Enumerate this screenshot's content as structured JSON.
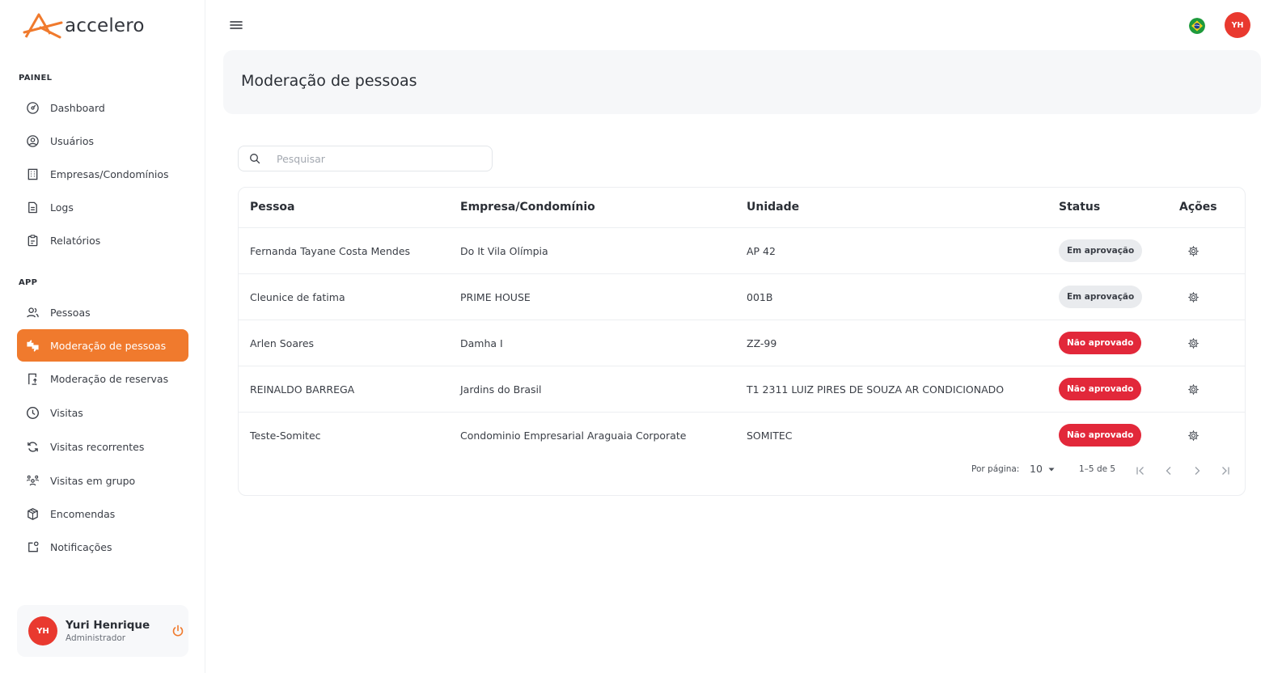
{
  "brand": {
    "name": "accelero",
    "accent": "#f07a2d",
    "avatar_color": "#e9392f"
  },
  "sidebar": {
    "section_painel": "PAINEL",
    "section_app": "APP",
    "items": [
      {
        "label": "Dashboard",
        "icon": "dashboard-icon"
      },
      {
        "label": "Usuários",
        "icon": "user-circle-icon"
      },
      {
        "label": "Empresas/Condomínios",
        "icon": "building-icon"
      },
      {
        "label": "Logs",
        "icon": "document-icon"
      },
      {
        "label": "Relatórios",
        "icon": "clipboard-icon"
      },
      {
        "label": "Pessoas",
        "icon": "people-icon"
      },
      {
        "label": "Moderação de pessoas",
        "icon": "thumbs-icon",
        "active": true
      },
      {
        "label": "Moderação de reservas",
        "icon": "reservation-icon"
      },
      {
        "label": "Visitas",
        "icon": "clock-icon"
      },
      {
        "label": "Visitas recorrentes",
        "icon": "refresh-icon"
      },
      {
        "label": "Visitas em grupo",
        "icon": "group-icon"
      },
      {
        "label": "Encomendas",
        "icon": "package-icon"
      },
      {
        "label": "Notificações",
        "icon": "notification-icon"
      }
    ]
  },
  "user": {
    "initials": "YH",
    "name": "Yuri Henrique",
    "role": "Administrador"
  },
  "topbar": {
    "avatar_initials": "YH"
  },
  "page": {
    "title": "Moderação de pessoas"
  },
  "search": {
    "placeholder": "Pesquisar"
  },
  "table": {
    "headers": {
      "pessoa": "Pessoa",
      "empresa": "Empresa/Condomínio",
      "unidade": "Unidade",
      "status": "Status",
      "acoes": "Ações"
    },
    "rows": [
      {
        "pessoa": "Fernanda Tayane Costa Mendes",
        "empresa": "Do It Vila Olímpia",
        "unidade": "AP 42",
        "status": "Em aprovação",
        "status_type": "pending"
      },
      {
        "pessoa": "Cleunice de fatima",
        "empresa": "PRIME HOUSE",
        "unidade": "001B",
        "status": "Em aprovação",
        "status_type": "pending"
      },
      {
        "pessoa": "Arlen Soares",
        "empresa": "Damha I",
        "unidade": "ZZ-99",
        "status": "Não aprovado",
        "status_type": "rejected"
      },
      {
        "pessoa": "REINALDO BARREGA",
        "empresa": "Jardins do Brasil",
        "unidade": "T1 2311 LUIZ PIRES DE SOUZA AR CONDICIONADO",
        "status": "Não aprovado",
        "status_type": "rejected"
      },
      {
        "pessoa": "Teste-Somitec",
        "empresa": "Condominio Empresarial Araguaia Corporate",
        "unidade": "SOMITEC",
        "status": "Não aprovado",
        "status_type": "rejected"
      }
    ]
  },
  "pagination": {
    "per_page_label": "Por página:",
    "per_page_value": "10",
    "range": "1–5 de 5"
  }
}
